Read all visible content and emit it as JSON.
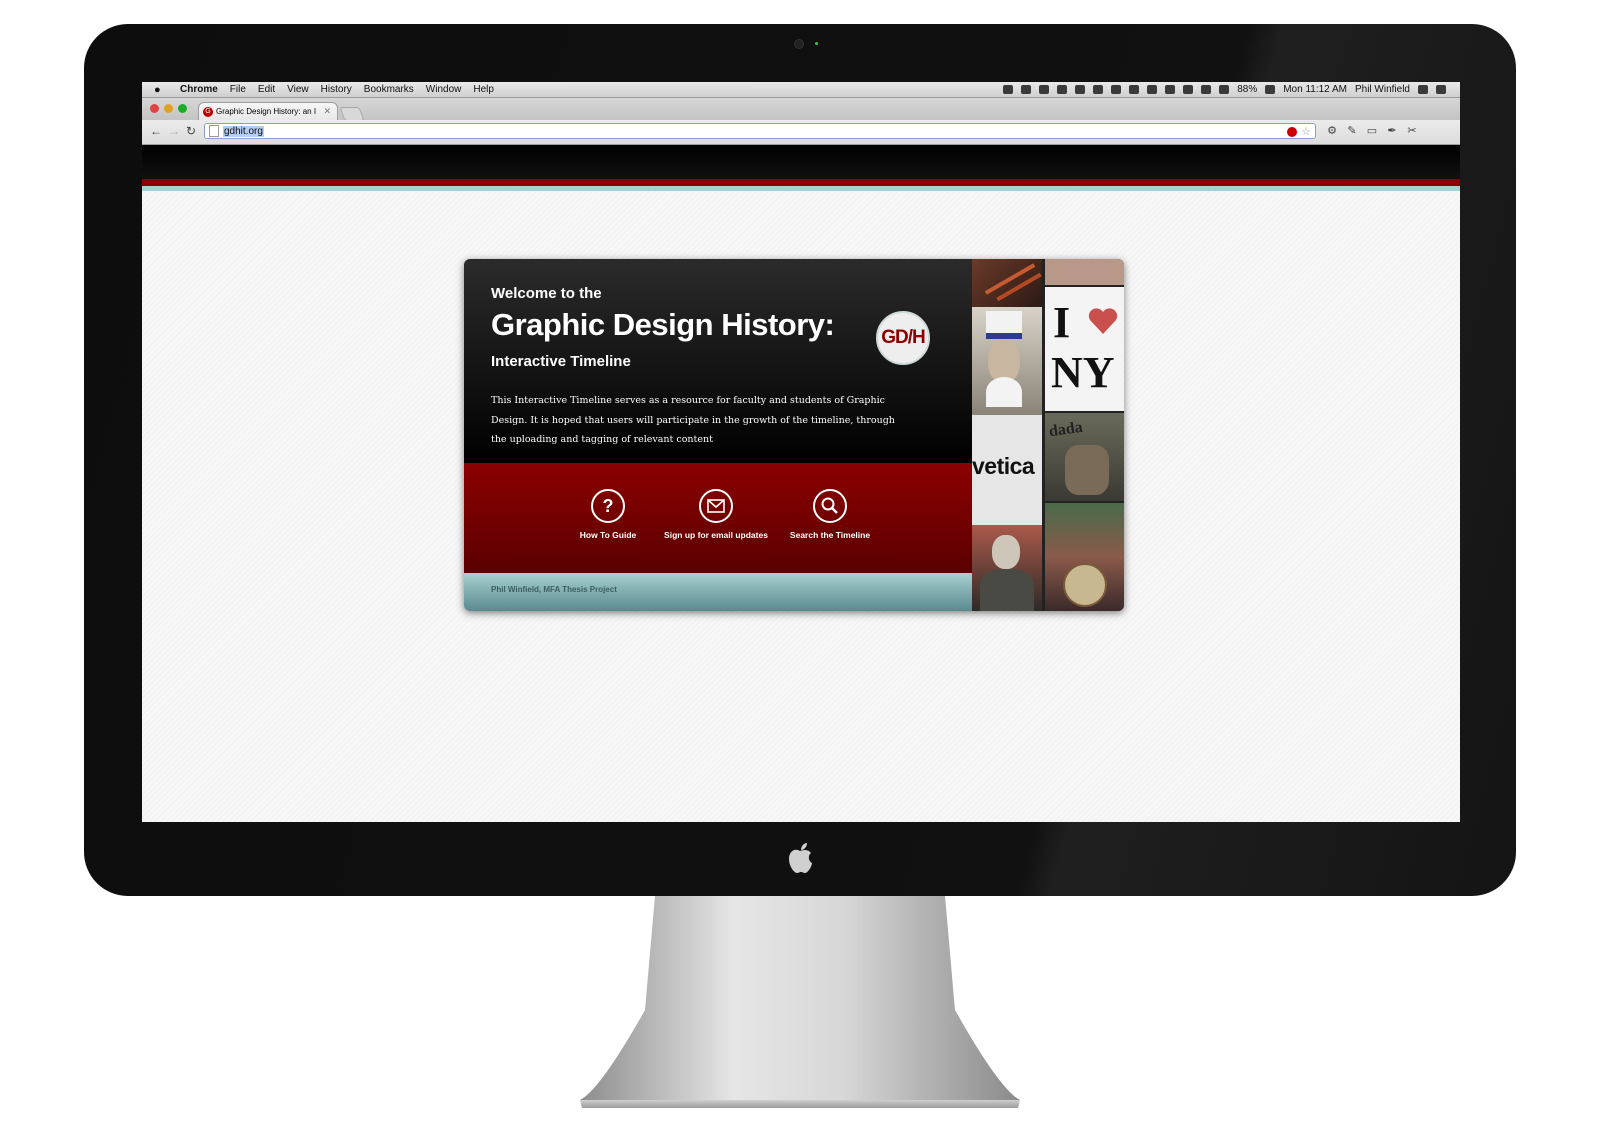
{
  "menubar": {
    "apple_symbol": "",
    "app_name": "Chrome",
    "items": [
      "File",
      "Edit",
      "View",
      "History",
      "Bookmarks",
      "Window",
      "Help"
    ],
    "battery": "88%",
    "clock": "Mon 11:12 AM",
    "user": "Phil Winfield"
  },
  "browser": {
    "tab_title": "Graphic Design History: an I",
    "tab_favicon": "G",
    "tab_close": "✕",
    "url": "gdhit.org",
    "back": "←",
    "forward": "→",
    "reload": "↻"
  },
  "card": {
    "welcome": "Welcome to the",
    "title": "Graphic Design History:",
    "subtitle": "Interactive Timeline",
    "logo": "GD/H",
    "description": "This Interactive Timeline serves as a resource for faculty and students of Graphic Design. It is hoped that users will participate in the growth of the timeline, through the uploading and tagging of relevant content",
    "actions": [
      {
        "label": "How To Guide",
        "icon": "question-icon"
      },
      {
        "label": "Sign up for email updates",
        "icon": "envelope-icon"
      },
      {
        "label": "Search the Timeline",
        "icon": "magnifier-icon"
      }
    ],
    "credit": "Phil Winfield, MFA Thesis Project"
  },
  "collage": {
    "ny_top": "I",
    "ny_bottom": "NY",
    "dada": "dada",
    "helvetica": "vetica"
  },
  "colors": {
    "accent_red": "#8c0000",
    "teal": "#a6d1d0",
    "dark": "#000000"
  }
}
